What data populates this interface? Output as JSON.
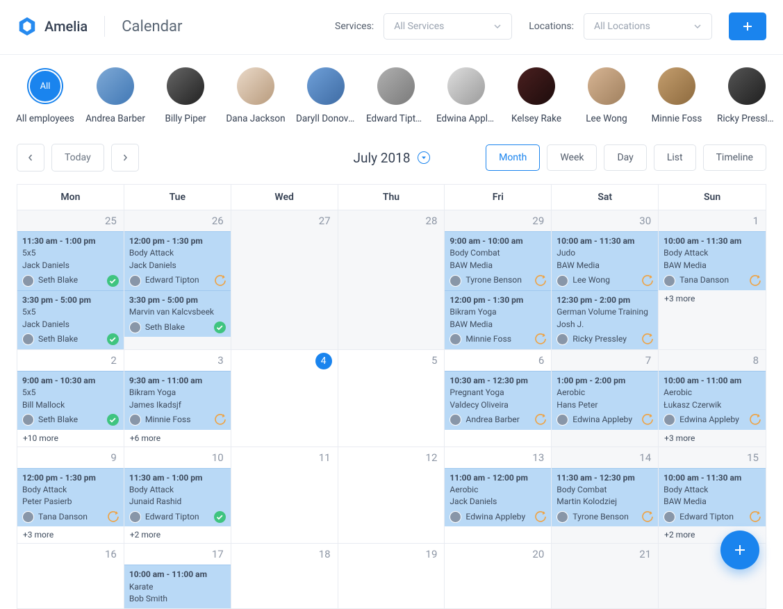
{
  "brand": "Amelia",
  "page_title": "Calendar",
  "filters": {
    "services_label": "Services:",
    "services_placeholder": "All Services",
    "locations_label": "Locations:",
    "locations_placeholder": "All Locations"
  },
  "employees": [
    {
      "name": "All employees",
      "all": true,
      "label": "All"
    },
    {
      "name": "Andrea Barber",
      "cls": "c1"
    },
    {
      "name": "Billy Piper",
      "cls": "c2"
    },
    {
      "name": "Dana Jackson",
      "cls": "c3"
    },
    {
      "name": "Daryll Donovan",
      "cls": "c4"
    },
    {
      "name": "Edward Tipton",
      "cls": "c5"
    },
    {
      "name": "Edwina Appleby",
      "cls": "c6"
    },
    {
      "name": "Kelsey Rake",
      "cls": "c7"
    },
    {
      "name": "Lee Wong",
      "cls": "c8"
    },
    {
      "name": "Minnie Foss",
      "cls": "c9"
    },
    {
      "name": "Ricky Pressley",
      "cls": "c10"
    },
    {
      "name": "Seth Blake",
      "cls": "c11"
    }
  ],
  "toolbar": {
    "today": "Today",
    "period": "July 2018",
    "views": [
      "Month",
      "Week",
      "Day",
      "List",
      "Timeline"
    ],
    "active_view": "Month"
  },
  "dow": [
    "Mon",
    "Tue",
    "Wed",
    "Thu",
    "Fri",
    "Sat",
    "Sun"
  ],
  "weeks": [
    [
      {
        "num": "25",
        "om": true,
        "events": [
          {
            "time": "11:30 am - 1:00 pm",
            "title": "5x5",
            "client": "Jack Daniels",
            "emp": "Seth Blake",
            "status": "ok"
          },
          {
            "time": "3:30 pm - 5:00 pm",
            "title": "5x5",
            "client": "Jack Daniels",
            "emp": "Seth Blake",
            "status": "ok"
          }
        ]
      },
      {
        "num": "26",
        "om": true,
        "events": [
          {
            "time": "12:00 pm - 1:30 pm",
            "title": "Body Attack",
            "client": "Jack Daniels",
            "emp": "Edward Tipton",
            "status": "pend"
          },
          {
            "time": "3:30 pm - 5:00 pm",
            "title": "Marvin van Kalcvsbeek",
            "client": "",
            "emp": "Seth Blake",
            "status": "ok"
          }
        ]
      },
      {
        "num": "27",
        "om": true,
        "events": []
      },
      {
        "num": "28",
        "om": true,
        "events": []
      },
      {
        "num": "29",
        "om": true,
        "events": [
          {
            "time": "9:00 am - 10:00 am",
            "title": "Body Combat",
            "client": "BAW Media",
            "emp": "Tyrone Benson",
            "status": "pend"
          },
          {
            "time": "12:00 pm - 1:30 pm",
            "title": "Bikram Yoga",
            "client": "BAW Media",
            "emp": "Minnie Foss",
            "status": "pend"
          }
        ]
      },
      {
        "num": "30",
        "om": true,
        "we": true,
        "events": [
          {
            "time": "10:00 am - 11:30 am",
            "title": "Judo",
            "client": "BAW Media",
            "emp": "Lee Wong",
            "status": "pend"
          },
          {
            "time": "12:30 pm - 2:00 pm",
            "title": "German Volume Training",
            "client": "Josh J.",
            "emp": "Ricky Pressley",
            "status": "pend"
          }
        ]
      },
      {
        "num": "1",
        "we": true,
        "events": [
          {
            "time": "10:00 am - 11:30 am",
            "title": "Body Attack",
            "client": "BAW Media",
            "emp": "Tana Danson",
            "status": "pend"
          }
        ],
        "more": "+3 more"
      }
    ],
    [
      {
        "num": "2",
        "events": [
          {
            "time": "9:00 am - 10:30 am",
            "title": "5x5",
            "client": "Bill Mallock",
            "emp": "Seth Blake",
            "status": "ok"
          }
        ],
        "more": "+10 more"
      },
      {
        "num": "3",
        "events": [
          {
            "time": "9:30 am - 11:00 am",
            "title": "Bikram Yoga",
            "client": "James Ikadsjf",
            "emp": "Minnie Foss",
            "status": "pend"
          }
        ],
        "more": "+6 more"
      },
      {
        "num": "4",
        "today": true,
        "events": []
      },
      {
        "num": "5",
        "events": []
      },
      {
        "num": "6",
        "events": [
          {
            "time": "10:30 am - 12:30 pm",
            "title": "Pregnant Yoga",
            "client": "Valdecy Oliveira",
            "emp": "Andrea Barber",
            "status": "pend"
          }
        ]
      },
      {
        "num": "7",
        "we": true,
        "events": [
          {
            "time": "1:00 pm - 2:00 pm",
            "title": "Aerobic",
            "client": "Hans Peter",
            "emp": "Edwina Appleby",
            "status": "pend"
          }
        ]
      },
      {
        "num": "8",
        "we": true,
        "events": [
          {
            "time": "10:00 am - 11:00 am",
            "title": "Aerobic",
            "client": "Łukasz Czerwik",
            "emp": "Edwina Appleby",
            "status": "pend"
          }
        ],
        "more": "+3 more"
      }
    ],
    [
      {
        "num": "9",
        "events": [
          {
            "time": "12:00 pm - 1:30 pm",
            "title": "Body Attack",
            "client": "Peter Pasierb",
            "emp": "Tana Danson",
            "status": "pend"
          }
        ],
        "more": "+3 more"
      },
      {
        "num": "10",
        "events": [
          {
            "time": "11:30 am - 1:00 pm",
            "title": "Body Attack",
            "client": "Junaid Rashid",
            "emp": "Edward Tipton",
            "status": "ok"
          }
        ],
        "more": "+2 more"
      },
      {
        "num": "11",
        "events": []
      },
      {
        "num": "12",
        "events": []
      },
      {
        "num": "13",
        "events": [
          {
            "time": "11:00 am - 12:00 pm",
            "title": "Aerobic",
            "client": "Jack Daniels",
            "emp": "Edwina Appleby",
            "status": "pend"
          }
        ]
      },
      {
        "num": "14",
        "we": true,
        "events": [
          {
            "time": "11:30 am - 12:30 pm",
            "title": "Body Combat",
            "client": "Martin Kolodziej",
            "emp": "Tyrone Benson",
            "status": "pend"
          }
        ]
      },
      {
        "num": "15",
        "we": true,
        "events": [
          {
            "time": "10:00 am - 11:30 am",
            "title": "Body Attack",
            "client": "BAW Media",
            "emp": "Edward Tipton",
            "status": "pend"
          }
        ],
        "more": "+2 more"
      }
    ],
    [
      {
        "num": "16",
        "events": []
      },
      {
        "num": "17",
        "events": [
          {
            "time": "10:00 am - 11:00 am",
            "title": "Karate",
            "client": "Bob Smith"
          }
        ]
      },
      {
        "num": "18",
        "events": []
      },
      {
        "num": "19",
        "events": []
      },
      {
        "num": "20",
        "events": []
      },
      {
        "num": "21",
        "we": true,
        "events": []
      },
      {
        "num": "",
        "we": true,
        "events": []
      }
    ]
  ]
}
